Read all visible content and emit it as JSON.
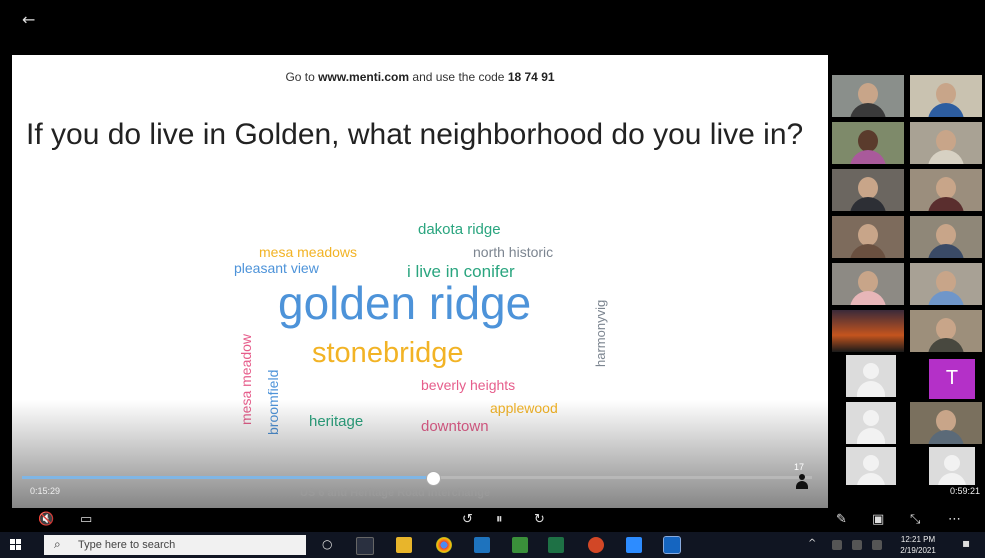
{
  "slide": {
    "instruction_prefix": "Go to",
    "instruction_url": "www.menti.com",
    "instruction_mid": "and use the code",
    "instruction_code": "18 74 91",
    "question": "If you do live in Golden, what neighborhood do you live in?"
  },
  "cloud_words": [
    {
      "text": "dakota ridge",
      "color": "#2aa57f",
      "size": 15
    },
    {
      "text": "mesa meadows",
      "color": "#f2b325",
      "size": 14
    },
    {
      "text": "north historic",
      "color": "#7c8590",
      "size": 14
    },
    {
      "text": "pleasant view",
      "color": "#4d93d9",
      "size": 14
    },
    {
      "text": "i live in conifer",
      "color": "#2aa57f",
      "size": 17
    },
    {
      "text": "golden ridge",
      "color": "#4d93d9",
      "size": 46
    },
    {
      "text": "harmonyvig",
      "color": "#7c8590",
      "size": 13
    },
    {
      "text": "stonebridge",
      "color": "#f2b325",
      "size": 29
    },
    {
      "text": "mesa meadow",
      "color": "#e65d8b",
      "size": 14
    },
    {
      "text": "broomfield",
      "color": "#4d93d9",
      "size": 14
    },
    {
      "text": "beverly heights",
      "color": "#e65d8b",
      "size": 14
    },
    {
      "text": "applewood",
      "color": "#f2b325",
      "size": 14
    },
    {
      "text": "heritage",
      "color": "#2aa57f",
      "size": 15
    },
    {
      "text": "downtown",
      "color": "#e65d8b",
      "size": 15
    }
  ],
  "player": {
    "elapsed": "0:15:29",
    "remaining": "0:59:21",
    "video_title": "US 6 and Heritage Road Interchange",
    "participant_count": "17",
    "progress_fraction": 0.52
  },
  "gallery": {
    "letter_tile": "T"
  },
  "controls": {
    "back_glyph": "←",
    "mute_glyph": "🔇",
    "captions_glyph": "▭",
    "rewind_glyph": "↺",
    "pause_glyph": "⏸",
    "forward_glyph": "↻",
    "pen_glyph": "✎",
    "cast_glyph": "▣",
    "collapse_glyph": "⤡",
    "more_glyph": "⋯"
  },
  "taskbar": {
    "search_placeholder": "Type here to search",
    "search_glyph": "⌕",
    "taskview_glyph": "○",
    "clock_time": "12:21 PM",
    "clock_date": "2/19/2021",
    "tray_arrow": "^",
    "notif_glyph": "▪"
  },
  "colors": {
    "accent_blue": "#4d93d9",
    "menti_green": "#2aa57f",
    "menti_yellow": "#f2b325",
    "menti_pink": "#e65d8b",
    "menti_gray": "#7c8590"
  }
}
